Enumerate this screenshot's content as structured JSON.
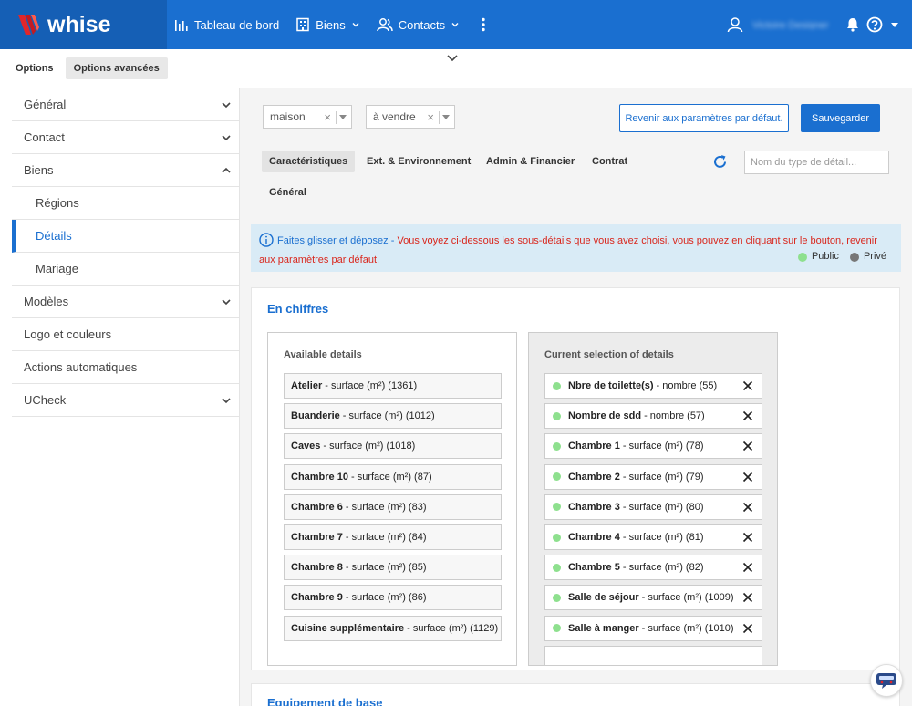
{
  "brand": {
    "logo_text": "whise",
    "topbar_color": "#1a6fd0",
    "logo_bg": "#155fb5"
  },
  "nav": {
    "items": [
      {
        "label": "Tableau de bord",
        "icon": "bar-chart-icon"
      },
      {
        "label": "Biens",
        "icon": "building-icon"
      },
      {
        "label": "Contacts",
        "icon": "users-icon"
      }
    ],
    "user_name": "Victoire Designer"
  },
  "subtabs": [
    {
      "label": "Options",
      "active": false
    },
    {
      "label": "Options avancées",
      "active": true
    }
  ],
  "sidebar": {
    "items": [
      {
        "label": "Général",
        "chevron": "down",
        "sub": false,
        "active": false
      },
      {
        "label": "Contact",
        "chevron": "down",
        "sub": false,
        "active": false
      },
      {
        "label": "Biens",
        "chevron": "up",
        "sub": false,
        "active": false
      },
      {
        "label": "Régions",
        "chevron": "",
        "sub": true,
        "active": false
      },
      {
        "label": "Détails",
        "chevron": "",
        "sub": true,
        "active": true
      },
      {
        "label": "Mariage",
        "chevron": "",
        "sub": true,
        "active": false
      },
      {
        "label": "Modèles",
        "chevron": "down",
        "sub": false,
        "active": false
      },
      {
        "label": "Logo et couleurs",
        "chevron": "",
        "sub": false,
        "active": false
      },
      {
        "label": "Actions automatiques",
        "chevron": "",
        "sub": false,
        "active": false
      },
      {
        "label": "UCheck",
        "chevron": "down",
        "sub": false,
        "active": false
      }
    ]
  },
  "filters": {
    "type": "maison",
    "status": "à vendre"
  },
  "buttons": {
    "reset": "Revenir aux paramètres par défaut.",
    "save": "Sauvegarder"
  },
  "tabs": [
    {
      "label": "Caractéristiques",
      "active": true
    },
    {
      "label": "Ext. & Environnement",
      "active": false
    },
    {
      "label": "Admin & Financier",
      "active": false
    },
    {
      "label": "Contrat",
      "active": false
    },
    {
      "label": "Général",
      "active": false
    }
  ],
  "search": {
    "placeholder": "Nom du type de détail..."
  },
  "info": {
    "highlight": "Faites glisser et déposez -",
    "text": " Vous voyez ci-dessous les sous-détails que vous avez choisi, vous pouvez en cliquant sur le bouton, revenir aux paramètres par défaut.",
    "legend_public": "Public",
    "legend_private": "Privé",
    "public_color": "#8ee08e",
    "private_color": "#777777"
  },
  "section": {
    "title": "En chiffres",
    "available_title": "Available details",
    "current_title": "Current selection of details",
    "available": [
      {
        "name": "Atelier",
        "desc": "- surface (m²) (1361)"
      },
      {
        "name": "Buanderie",
        "desc": "- surface (m²) (1012)"
      },
      {
        "name": "Caves",
        "desc": "- surface (m²) (1018)"
      },
      {
        "name": "Chambre 10",
        "desc": "- surface (m²) (87)"
      },
      {
        "name": "Chambre 6",
        "desc": "- surface (m²) (83)"
      },
      {
        "name": "Chambre 7",
        "desc": "- surface (m²) (84)"
      },
      {
        "name": "Chambre 8",
        "desc": "- surface (m²) (85)"
      },
      {
        "name": "Chambre 9",
        "desc": "- surface (m²) (86)"
      },
      {
        "name": "Cuisine supplémentaire",
        "desc": "- surface (m²) (1129)"
      }
    ],
    "current": [
      {
        "name": "Nbre de toilette(s)",
        "desc": "- nombre (55)"
      },
      {
        "name": "Nombre de sdd",
        "desc": "- nombre (57)"
      },
      {
        "name": "Chambre 1",
        "desc": "- surface (m²) (78)"
      },
      {
        "name": "Chambre 2",
        "desc": "- surface (m²) (79)"
      },
      {
        "name": "Chambre 3",
        "desc": "- surface (m²) (80)"
      },
      {
        "name": "Chambre 4",
        "desc": "- surface (m²) (81)"
      },
      {
        "name": "Chambre 5",
        "desc": "- surface (m²) (82)"
      },
      {
        "name": "Salle de séjour",
        "desc": "- surface (m²) (1009)"
      },
      {
        "name": "Salle à manger",
        "desc": "- surface (m²) (1010)"
      }
    ]
  },
  "section2": {
    "title": "Equipement de base"
  }
}
